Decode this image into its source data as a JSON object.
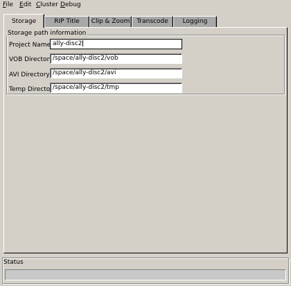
{
  "menu": [
    {
      "label": "File",
      "underline": "F",
      "rest": "ile"
    },
    {
      "label": "Edit",
      "underline": "E",
      "rest": "dit"
    },
    {
      "label": "Cluster",
      "underline": "C",
      "rest": "luster"
    },
    {
      "label": "Debug",
      "underline": "D",
      "rest": "ebug"
    }
  ],
  "tabs": [
    {
      "label": "Storage",
      "active": true
    },
    {
      "label": "RIP Title",
      "active": false
    },
    {
      "label": "Clip & Zoom",
      "active": false
    },
    {
      "label": "Transcode",
      "active": false
    },
    {
      "label": "Logging",
      "active": false
    }
  ],
  "storage": {
    "group_title": "Storage path information",
    "fields": [
      {
        "label": "Project Name",
        "value": "ally-disc2"
      },
      {
        "label": "VOB Directory",
        "value": "/space/ally-disc2/vob"
      },
      {
        "label": "AVI Directory",
        "value": "/space/ally-disc2/avi"
      },
      {
        "label": "Temp Directory",
        "value": "/space/ally-disc2/tmp"
      }
    ]
  },
  "status": {
    "title": "Status",
    "text": ""
  }
}
